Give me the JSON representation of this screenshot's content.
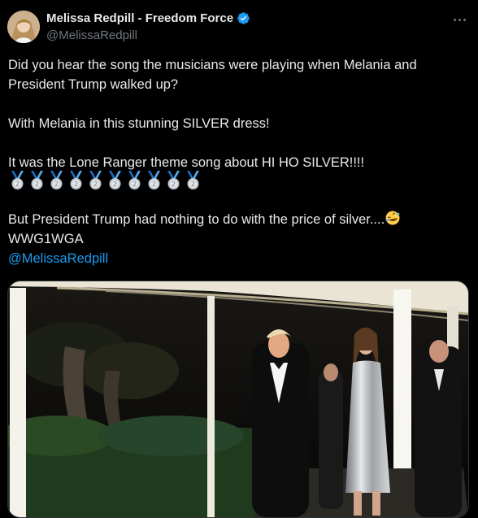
{
  "author": {
    "display_name": "Melissa Redpill - Freedom Force",
    "handle": "@MelissaRedpill",
    "verified": true,
    "avatar_icon": "profile-photo"
  },
  "tweet": {
    "line1": "Did you hear the song the musicians were playing when Melania and",
    "line2": "President Trump walked up?",
    "line3": "With Melania in this stunning SILVER dress!",
    "line4": "It was the Lone Ranger theme song about HI HO SILVER!!!!",
    "medal_emoji": "🥈",
    "medal_count": 10,
    "line5": "But President Trump had nothing to do with the price of silver....",
    "laugh_emoji": "🤣",
    "line6": "WWG1WGA",
    "mention": "@MelissaRedpill"
  },
  "colors": {
    "background": "#000000",
    "text": "#e7e9ea",
    "secondary": "#71767b",
    "accent": "#1d9bf0",
    "border": "#2f3336"
  },
  "icons": {
    "verified": "verified-badge-icon",
    "more": "more-options-icon"
  }
}
